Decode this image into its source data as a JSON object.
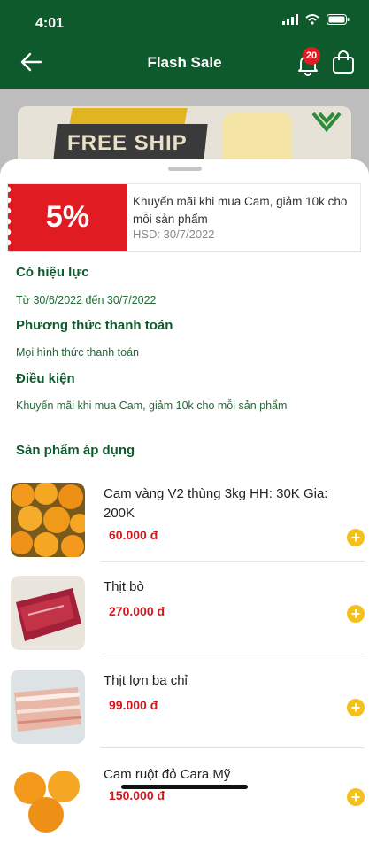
{
  "status": {
    "time": "4:01"
  },
  "header": {
    "title": "Flash Sale",
    "notification_count": "20"
  },
  "banner": {
    "text": "FREE SHIP"
  },
  "voucher": {
    "percent": "5%",
    "description": "Khuyến mãi khi mua Cam, giảm 10k cho mỗi sản phẩm",
    "expiry": "HSD: 30/7/2022"
  },
  "sections": {
    "validity_title": "Có hiệu lực",
    "validity_text": "Từ 30/6/2022 đến 30/7/2022",
    "payment_title": "Phương thức thanh toán",
    "payment_text": "Mọi hình thức thanh toán",
    "condition_title": "Điều kiện",
    "condition_text": "Khuyến mãi khi mua Cam, giảm 10k cho mỗi sản phẩm",
    "products_title": "Sản phẩm áp dụng"
  },
  "products": [
    {
      "name": "Cam vàng V2 thùng 3kg HH: 30K Gia: 200K",
      "price": "60.000 đ"
    },
    {
      "name": "Thịt bò",
      "price": "270.000 đ"
    },
    {
      "name": "Thịt lợn ba chỉ",
      "price": "99.000 đ"
    },
    {
      "name": "Cam ruột đỏ Cara Mỹ",
      "price": "150.000 đ"
    }
  ],
  "colors": {
    "header_green": "#0f5a2c",
    "sale_red": "#e11b22",
    "price_red": "#d3171c",
    "add_yellow": "#f4c01e"
  }
}
